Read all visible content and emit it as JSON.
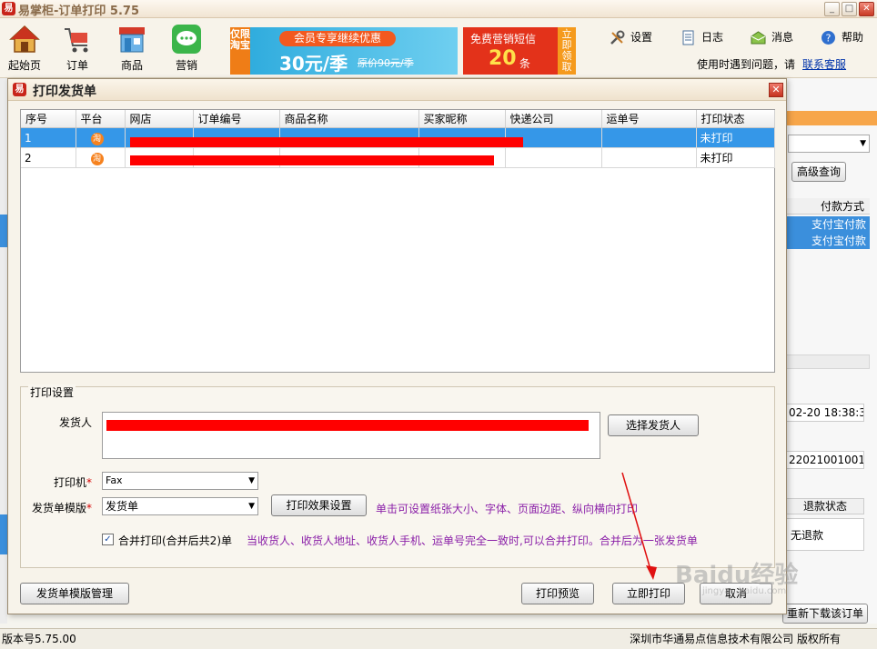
{
  "app": {
    "title": "易掌柜-订单打印 5.75",
    "logo_char": "易",
    "minimize": "_",
    "maximize": "□",
    "close": "✕"
  },
  "toolbar": {
    "items": [
      {
        "label": "起始页",
        "icon": "home-icon"
      },
      {
        "label": "订单",
        "icon": "cart-icon"
      },
      {
        "label": "商品",
        "icon": "shop-icon"
      },
      {
        "label": "营销",
        "icon": "chat-icon"
      }
    ],
    "ad_taobao": {
      "side": "仅限淘宝",
      "pill": "会员专享继续优惠",
      "price": "30元/季",
      "original": "原价90元/季"
    },
    "ad_sms": {
      "title": "免费营销短信",
      "count": "20",
      "unit": "条",
      "side": "立即领取"
    },
    "nav": [
      {
        "label": "设置",
        "icon": "tools-icon"
      },
      {
        "label": "日志",
        "icon": "log-icon"
      },
      {
        "label": "消息",
        "icon": "message-icon"
      },
      {
        "label": "帮助",
        "icon": "help-icon"
      }
    ],
    "help_text": "使用时遇到问题，请",
    "help_link": "联系客服"
  },
  "background": {
    "advanced_query": "高级查询",
    "payment_header": "付款方式",
    "payment_rows": [
      "支付宝付款",
      "支付宝付款"
    ],
    "time_value": "02-20 18:38:3",
    "order_value": "22021001001",
    "refund_header": "退款状态",
    "refund_value": "无退款",
    "redownload": "重新下载该订单"
  },
  "statusbar": {
    "version": "版本号5.75.00",
    "copyright": "深圳市华通易点信息技术有限公司 版权所有"
  },
  "dialog": {
    "title": "打印发货单",
    "logo_char": "易",
    "close": "✕",
    "columns": [
      "序号",
      "平台",
      "网店",
      "订单编号",
      "商品名称",
      "买家昵称",
      "快递公司",
      "运单号",
      "打印状态"
    ],
    "rows": [
      {
        "no": "1",
        "platform": "淘",
        "shop": "",
        "order": "",
        "product": "",
        "buyer": "",
        "express": "",
        "waybill": "",
        "status": "未打印"
      },
      {
        "no": "2",
        "platform": "淘",
        "shop": "",
        "order": "",
        "product": "",
        "buyer": "",
        "express": "",
        "waybill": "",
        "status": "未打印"
      }
    ],
    "settings_legend": "打印设置",
    "shipper_label": "发货人",
    "select_shipper": "选择发货人",
    "printer_label": "打印机",
    "printer_value": "Fax",
    "template_label": "发货单模版",
    "template_value": "发货单",
    "effect_button": "打印效果设置",
    "effect_hint": "单击可设置纸张大小、字体、页面边距、纵向横向打印",
    "required_mark": "*",
    "merge_checked": "✓",
    "merge_label": "合并打印(合并后共2)单",
    "merge_hint": "当收货人、收货人地址、收货人手机、运单号完全一致时,可以合并打印。合并后为一张发货单",
    "template_manage": "发货单模版管理",
    "preview": "打印预览",
    "print_now": "立即打印",
    "cancel": "取消"
  },
  "watermark": {
    "brand": "Baidu经验",
    "url": "jingyan.baidu.com"
  },
  "colors": {
    "selection_blue": "#3597e8",
    "redaction_red": "#ff0000",
    "hint_purple": "#8a1fa8",
    "accent_orange": "#f7a64a"
  }
}
